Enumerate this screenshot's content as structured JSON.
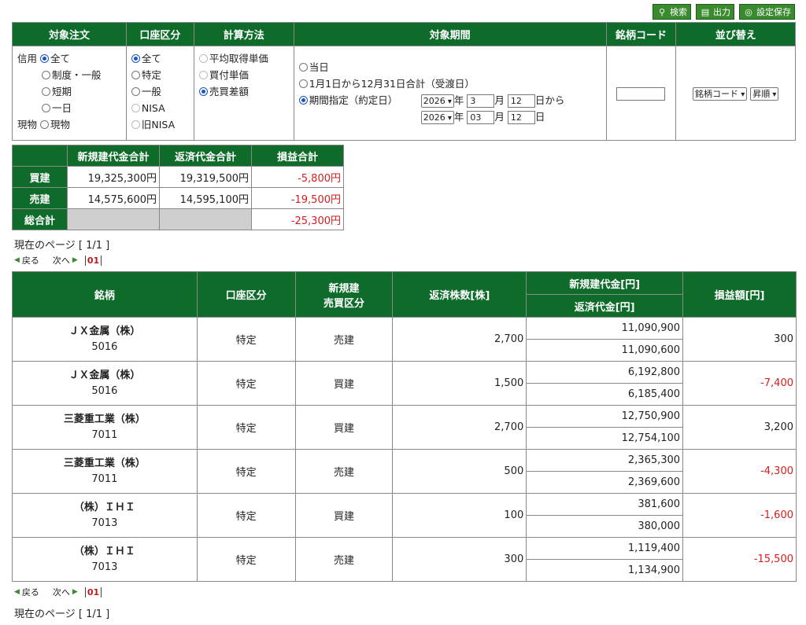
{
  "toolbar": {
    "search": "検索",
    "output": "出力",
    "save": "設定保存"
  },
  "filter": {
    "headers": [
      "対象注文",
      "口座区分",
      "計算方法",
      "対象期間",
      "銘柄コード",
      "並び替え"
    ],
    "order": {
      "margin_label": "信用",
      "spot_label": "現物",
      "options": [
        "全て",
        "制度・一般",
        "短期",
        "一日"
      ],
      "spot_option": "現物"
    },
    "account": {
      "options": [
        "全て",
        "特定",
        "一般",
        "NISA",
        "旧NISA"
      ]
    },
    "calc": {
      "options": [
        "平均取得単価",
        "買付単価",
        "売買差額"
      ]
    },
    "period": {
      "opt1": "当日",
      "opt2": "1月1日から12月31日合計（受渡日）",
      "opt3": "期間指定（約定日）",
      "from": {
        "year": "2026",
        "month": "3",
        "day": "12",
        "suffix": "日から"
      },
      "to": {
        "year": "2026",
        "month": "03",
        "day": "12",
        "suffix": "日"
      },
      "year_unit": "年",
      "month_unit": "月"
    },
    "code_value": "",
    "sort": {
      "key": "銘柄コード",
      "order": "昇順"
    }
  },
  "summary": {
    "headers": [
      "新規建代金合計",
      "返済代金合計",
      "損益合計"
    ],
    "rows": [
      {
        "label": "買建",
        "new": "19,325,300円",
        "close": "19,319,500円",
        "pl": "-5,800円"
      },
      {
        "label": "売建",
        "new": "14,575,600円",
        "close": "14,595,100円",
        "pl": "-19,500円"
      },
      {
        "label": "総合計",
        "pl": "-25,300円"
      }
    ]
  },
  "paging": {
    "current": "現在のページ [ 1/1 ]",
    "prev": "戻る",
    "next": "次へ",
    "page": "01"
  },
  "detail": {
    "headers": {
      "name": "銘柄",
      "account": "口座区分",
      "side1": "新規建",
      "side2": "売買区分",
      "qty": "返済株数[株]",
      "new_amt": "新規建代金[円]",
      "close_amt": "返済代金[円]",
      "pl": "損益額[円]"
    },
    "rows": [
      {
        "name": "ＪＸ金属（株）",
        "code": "5016",
        "account": "特定",
        "side": "売建",
        "qty": "2,700",
        "new_amt": "11,090,900",
        "close_amt": "11,090,600",
        "pl": "300"
      },
      {
        "name": "ＪＸ金属（株）",
        "code": "5016",
        "account": "特定",
        "side": "買建",
        "qty": "1,500",
        "new_amt": "6,192,800",
        "close_amt": "6,185,400",
        "pl": "-7,400"
      },
      {
        "name": "三菱重工業（株）",
        "code": "7011",
        "account": "特定",
        "side": "買建",
        "qty": "2,700",
        "new_amt": "12,750,900",
        "close_amt": "12,754,100",
        "pl": "3,200"
      },
      {
        "name": "三菱重工業（株）",
        "code": "7011",
        "account": "特定",
        "side": "売建",
        "qty": "500",
        "new_amt": "2,365,300",
        "close_amt": "2,369,600",
        "pl": "-4,300"
      },
      {
        "name": "（株）ＩＨＩ",
        "code": "7013",
        "account": "特定",
        "side": "買建",
        "qty": "100",
        "new_amt": "381,600",
        "close_amt": "380,000",
        "pl": "-1,600"
      },
      {
        "name": "（株）ＩＨＩ",
        "code": "7013",
        "account": "特定",
        "side": "売建",
        "qty": "300",
        "new_amt": "1,119,400",
        "close_amt": "1,134,900",
        "pl": "-15,500"
      }
    ]
  },
  "colors": {
    "header_bg": "#0f6b2a",
    "negative": "#d61e1e",
    "button_bg": "#3a8a2e"
  }
}
